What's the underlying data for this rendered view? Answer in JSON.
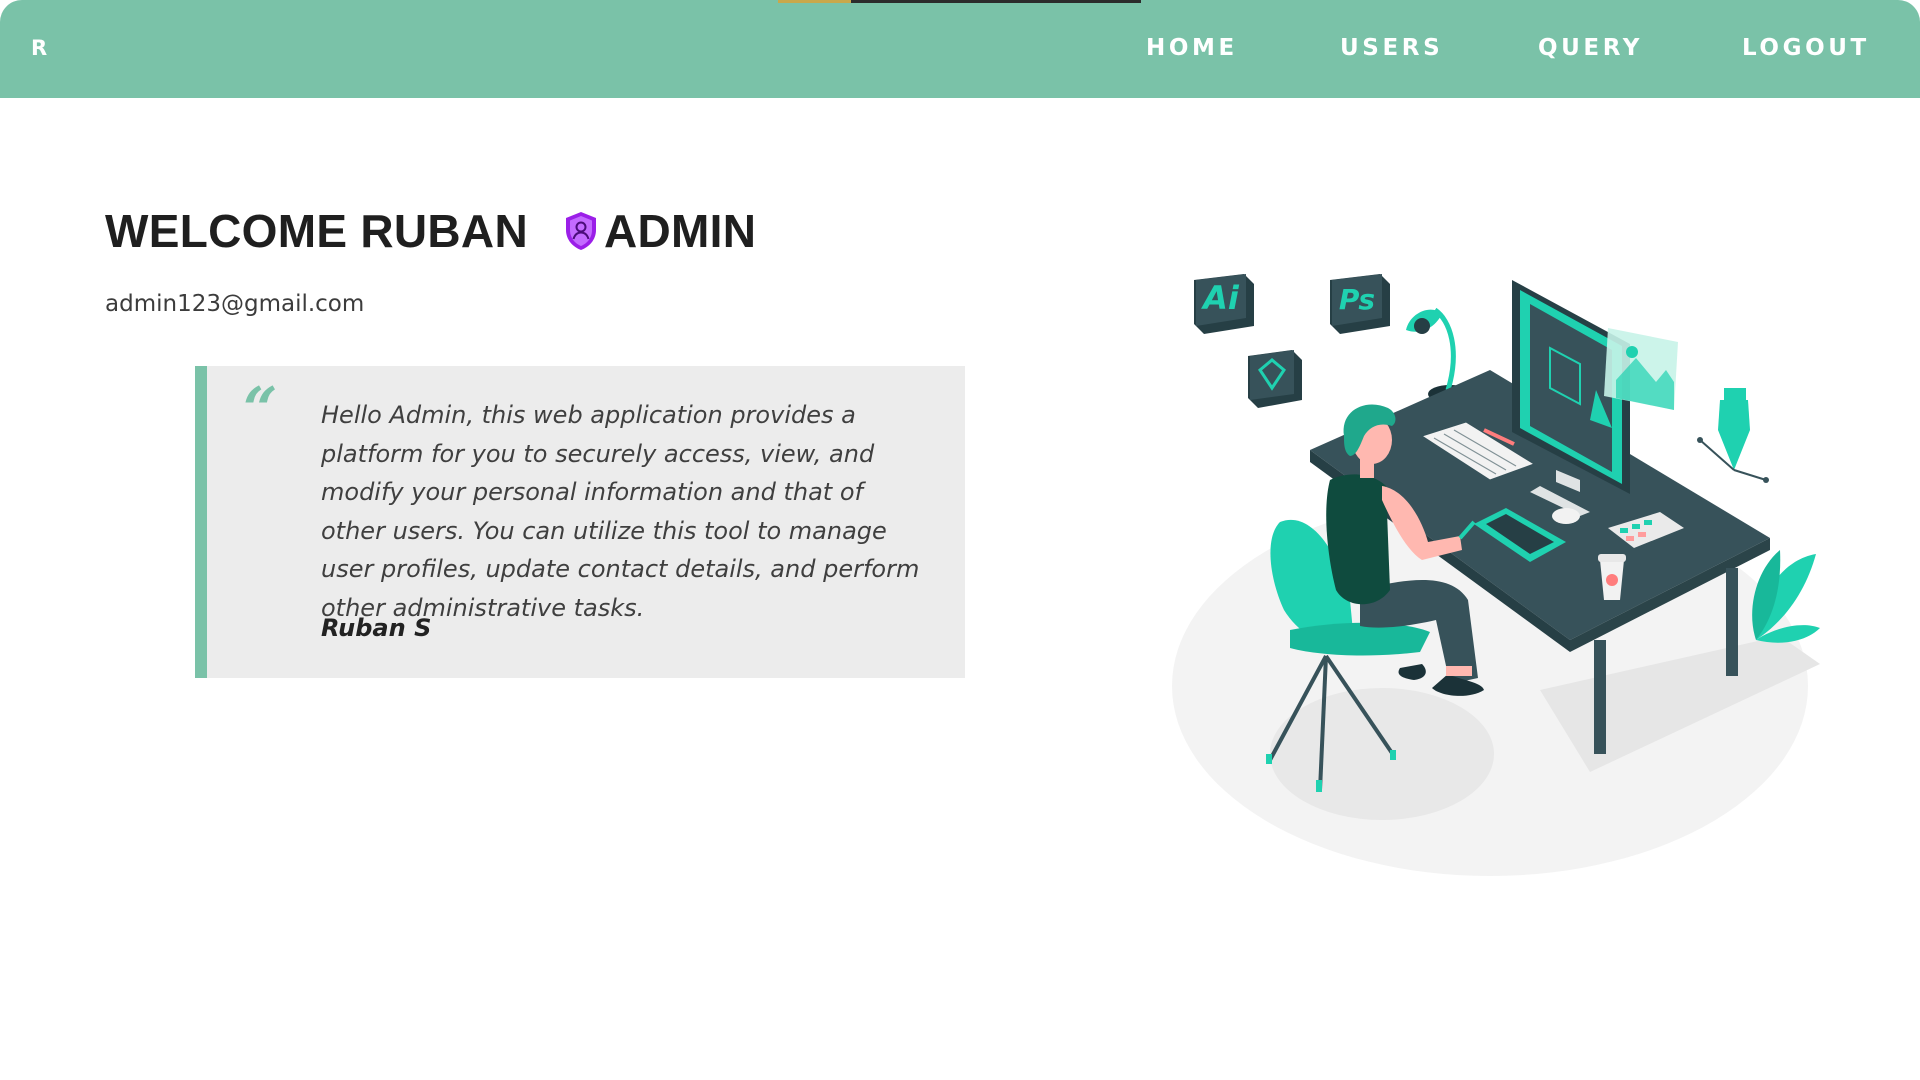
{
  "header": {
    "brand": "R",
    "nav": {
      "home": "HOME",
      "users": "USERS",
      "query": "QUERY",
      "logout": "LOGOUT"
    }
  },
  "welcome": {
    "greeting": "WELCOME RUBAN",
    "role": "ADMIN",
    "role_icon": "shield-user-icon",
    "email": "admin123@gmail.com"
  },
  "quote": {
    "mark": "“",
    "text": "Hello Admin, this web application provides a platform for you to securely access, view, and modify your personal information and that of other users. You can utilize this tool to manage user profiles, update contact details, and perform other administrative tasks.",
    "author": "Ruban S"
  },
  "illustration": {
    "app_badges": [
      "Ai",
      "Ps"
    ]
  },
  "colors": {
    "header_bg": "#7ac2a8",
    "accent": "#7ac2a8",
    "quote_bg": "#ececec",
    "role_icon": "#9b1fe8",
    "illustration_teal": "#1fd1b0",
    "illustration_dark": "#37525a"
  }
}
